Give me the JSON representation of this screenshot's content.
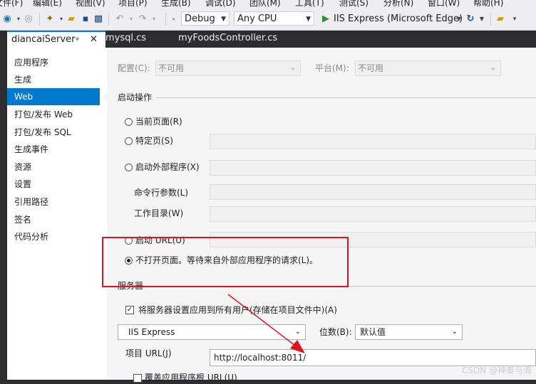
{
  "menubar": {
    "items": [
      "文件(F)",
      "编辑(E)",
      "视图(V)",
      "项目(P)",
      "生成(B)",
      "调试(D)",
      "团队(M)",
      "工具(T)",
      "测试(S)",
      "分析(N)",
      "窗口(W)",
      "帮助(H)"
    ]
  },
  "toolbar": {
    "configuration": "Debug",
    "platform": "Any CPU",
    "run_target": "IIS Express (Microsoft Edge)"
  },
  "tabs": {
    "active": "diancaiServer",
    "pin_glyph": "ᵠ",
    "close_glyph": "✕",
    "others": [
      "mysql.cs",
      "myFoodsController.cs"
    ]
  },
  "nav": {
    "items": [
      "应用程序",
      "生成",
      "Web",
      "打包/发布 Web",
      "打包/发布 SQL",
      "生成事件",
      "资源",
      "设置",
      "引用路径",
      "签名",
      "代码分析"
    ],
    "selected_index": 2
  },
  "config_bar": {
    "config_label": "配置(C):",
    "config_value": "不可用",
    "platform_label": "平台(M):",
    "platform_value": "不可用"
  },
  "start_action": {
    "title": "启动操作",
    "current_page": "当前页面(R)",
    "specific_page": "特定页(S)",
    "external_program": "启动外部程序(X)",
    "cmd_args": "命令行参数(L)",
    "working_dir": "工作目录(W)",
    "start_url": "启动 URL(U)",
    "dont_open": "不打开页面。等待来自外部应用程序的请求(L)。",
    "selected": "dont_open"
  },
  "servers": {
    "title": "服务器",
    "apply_all_users": "将服务器设置应用到所有用户(存储在项目文件中)(A)",
    "apply_all_users_checked": true,
    "server_value": "IIS Express",
    "bitness_label": "位数(B):",
    "bitness_value": "默认值",
    "project_url_label": "项目 URL(J)",
    "project_url_value": "http://localhost:8011/",
    "override_root": "覆盖应用程序根 URL(U)",
    "override_root_checked": false
  },
  "watermark": "CSDN @神秦与海",
  "colors": {
    "accent": "#007acc",
    "highlight": "#e0141e",
    "arrow": "#e0141e",
    "run_green": "#388a34"
  }
}
